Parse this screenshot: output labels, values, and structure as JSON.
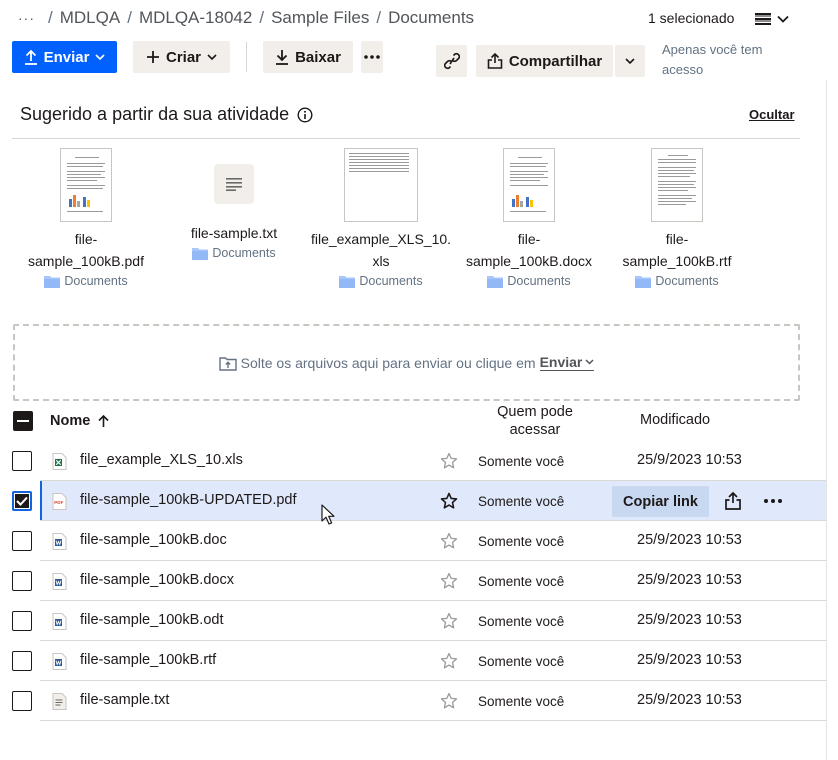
{
  "breadcrumb": {
    "more": "···",
    "items": [
      "MDLQA",
      "MDLQA-18042",
      "Sample Files"
    ],
    "current": "Documents"
  },
  "selection": {
    "count_label": "1 selecionado"
  },
  "toolbar": {
    "upload_label": "Enviar",
    "create_label": "Criar",
    "download_label": "Baixar",
    "share_label": "Compartilhar",
    "access_note": "Apenas você tem acesso"
  },
  "suggested": {
    "title": "Sugerido a partir da sua atividade",
    "hide_label": "Ocultar",
    "cards": [
      {
        "name_line1": "file-",
        "name_line2": "sample_100kB.pdf",
        "location": "Documents",
        "thumb": "pdf"
      },
      {
        "name_line1": "file-sample.txt",
        "name_line2": "",
        "location": "Documents",
        "thumb": "txt"
      },
      {
        "name_line1": "file_example_XLS_10.",
        "name_line2": "xls",
        "location": "Documents",
        "thumb": "xls"
      },
      {
        "name_line1": "file-",
        "name_line2": "sample_100kB.docx",
        "location": "Documents",
        "thumb": "docx"
      },
      {
        "name_line1": "file-",
        "name_line2": "sample_100kB.rtf",
        "location": "Documents",
        "thumb": "rtf"
      }
    ]
  },
  "dropzone": {
    "text": "Solte os arquivos aqui para enviar ou clique em",
    "link": "Enviar"
  },
  "table": {
    "col_name": "Nome",
    "col_access": "Quem pode acessar",
    "col_modified": "Modificado",
    "copy_link_label": "Copiar link",
    "rows": [
      {
        "name": "file_example_XLS_10.xls",
        "type": "xls",
        "access": "Somente você",
        "modified": "25/9/2023 10:53",
        "selected": false
      },
      {
        "name": "file-sample_100kB-UPDATED.pdf",
        "type": "pdf",
        "access": "Somente você",
        "modified": "",
        "selected": true
      },
      {
        "name": "file-sample_100kB.doc",
        "type": "doc",
        "access": "Somente você",
        "modified": "25/9/2023 10:53",
        "selected": false
      },
      {
        "name": "file-sample_100kB.docx",
        "type": "doc",
        "access": "Somente você",
        "modified": "25/9/2023 10:53",
        "selected": false
      },
      {
        "name": "file-sample_100kB.odt",
        "type": "doc",
        "access": "Somente você",
        "modified": "25/9/2023 10:53",
        "selected": false
      },
      {
        "name": "file-sample_100kB.rtf",
        "type": "doc",
        "access": "Somente você",
        "modified": "25/9/2023 10:53",
        "selected": false
      },
      {
        "name": "file-sample.txt",
        "type": "txt",
        "access": "Somente você",
        "modified": "25/9/2023 10:53",
        "selected": false
      }
    ]
  },
  "colors": {
    "primary": "#0061fe",
    "selected_row": "#dfe9fb",
    "selected_border": "#1363dd",
    "secondary_btn": "#f2efea"
  }
}
